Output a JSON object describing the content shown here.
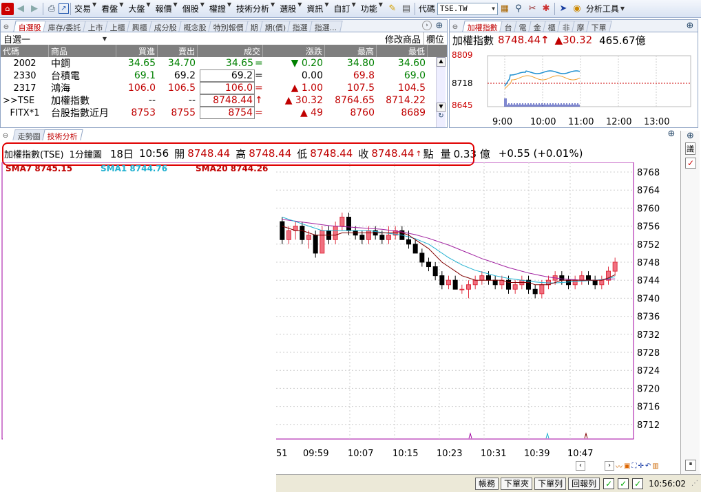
{
  "toolbar": {
    "menus": [
      "交易",
      "看盤",
      "大盤",
      "報價",
      "個股",
      "權證",
      "技術分析",
      "選股",
      "資訊",
      "自訂",
      "功能"
    ],
    "code_label": "代碼",
    "code_value": "TSE.TW",
    "analysis_tools": "分析工具"
  },
  "quote_panel": {
    "tabs": [
      "自選股",
      "庫存/委託",
      "上市",
      "上櫃",
      "興櫃",
      "成分股",
      "概念股",
      "特別報價",
      "期",
      "期(價)",
      "指選",
      "指選..."
    ],
    "group_name": "自選一",
    "edit_label": "修改商品",
    "column_label": "欄位",
    "headers": [
      "代碼",
      "商品",
      "買進",
      "賣出",
      "成交",
      "漲跌",
      "最高",
      "最低"
    ],
    "rows": [
      {
        "code": "2002",
        "name": "中鋼",
        "bid": "34.65",
        "ask": "34.70",
        "last": "34.65",
        "mark": "=",
        "chg": "0.20",
        "chg_sign": "down",
        "high": "34.80",
        "low": "34.60",
        "color": "dn"
      },
      {
        "code": "2330",
        "name": "台積電",
        "bid": "69.1",
        "ask": "69.2",
        "last": "69.2",
        "mark": "=",
        "chg": "0.00",
        "chg_sign": "none",
        "high": "69.8",
        "low": "69.0",
        "color": "flat"
      },
      {
        "code": "2317",
        "name": "鴻海",
        "bid": "106.0",
        "ask": "106.5",
        "last": "106.0",
        "mark": "=",
        "chg": "1.00",
        "chg_sign": "up",
        "high": "107.5",
        "low": "104.5",
        "color": "up"
      },
      {
        "code": ">>TSE",
        "name": "加權指數",
        "bid": "--",
        "ask": "--",
        "last": "8748.44",
        "mark": "↑",
        "chg": "30.32",
        "chg_sign": "up",
        "high": "8764.65",
        "low": "8714.22",
        "color": "up"
      },
      {
        "code": "FITX*1",
        "name": "台股指數近月",
        "bid": "8753",
        "ask": "8755",
        "last": "8754",
        "mark": "=",
        "chg": "49",
        "chg_sign": "up",
        "high": "8760",
        "low": "8689",
        "color": "up"
      }
    ]
  },
  "index_panel": {
    "tabs": [
      "加權指數",
      "台",
      "電",
      "金",
      "櫃",
      "非",
      "摩",
      "下單"
    ],
    "name": "加權指數",
    "value": "8748.44",
    "arrow": "↑",
    "change": "30.32",
    "volume": "465.67億",
    "y_ticks": [
      "8809",
      "8718",
      "8645"
    ],
    "x_ticks": [
      "9:00",
      "10:00",
      "11:00",
      "12:00",
      "13:00"
    ]
  },
  "chart_panel": {
    "tabs": [
      "走勢圖",
      "技術分析"
    ],
    "title": "加權指數(TSE)",
    "period": "1分鐘圖",
    "date": "18日",
    "time": "10:56",
    "open_label": "開",
    "open": "8748.44",
    "high_label": "高",
    "high": "8748.44",
    "low_label": "低",
    "low": "8748.44",
    "close_label": "收",
    "close": "8748.44",
    "points_label": "點",
    "volume_label": "量",
    "volume": "0.33 億",
    "change": "+0.55 (+0.01%)",
    "ma_labels": [
      "SMA7 8745.15",
      "SMA1 8744.76",
      "SMA20 8744.26"
    ],
    "y_ticks": [
      "8768",
      "8764",
      "8760",
      "8756",
      "8752",
      "8748",
      "8744",
      "8740",
      "8736",
      "8732",
      "8728",
      "8724",
      "8720",
      "8716",
      "8712"
    ],
    "x_ticks": [
      "51",
      "09:59",
      "10:07",
      "10:15",
      "10:23",
      "10:31",
      "10:39",
      "10:47"
    ],
    "side_label": "議"
  },
  "status_bar": {
    "buttons": [
      "帳務",
      "下單夾",
      "下單列",
      "回報列"
    ],
    "time": "10:56:02"
  },
  "chart_data": {
    "type": "candlestick",
    "ylim": [
      8710,
      8770
    ],
    "y_ticks": [
      8768,
      8764,
      8760,
      8756,
      8752,
      8748,
      8744,
      8740,
      8736,
      8732,
      8728,
      8724,
      8720,
      8716,
      8712
    ],
    "x_ticks": [
      "09:59",
      "10:07",
      "10:15",
      "10:23",
      "10:31",
      "10:39",
      "10:47"
    ],
    "candles": [
      [
        8757,
        8758,
        8752,
        8753
      ],
      [
        8753,
        8756,
        8752,
        8755
      ],
      [
        8755,
        8757,
        8753,
        8756
      ],
      [
        8756,
        8757,
        8752,
        8753
      ],
      [
        8753,
        8755,
        8751,
        8754
      ],
      [
        8754,
        8755,
        8749,
        8750
      ],
      [
        8750,
        8756,
        8750,
        8755
      ],
      [
        8755,
        8756,
        8752,
        8753
      ],
      [
        8753,
        8757,
        8752,
        8756
      ],
      [
        8756,
        8759,
        8755,
        8758
      ],
      [
        8758,
        8759,
        8754,
        8755
      ],
      [
        8755,
        8756,
        8753,
        8754
      ],
      [
        8754,
        8755,
        8752,
        8753
      ],
      [
        8753,
        8756,
        8752,
        8755
      ],
      [
        8755,
        8756,
        8753,
        8754
      ],
      [
        8754,
        8755,
        8752,
        8753
      ],
      [
        8753,
        8756,
        8752,
        8754
      ],
      [
        8754,
        8756,
        8753,
        8755
      ],
      [
        8755,
        8756,
        8753,
        8753
      ],
      [
        8753,
        8755,
        8751,
        8752
      ],
      [
        8752,
        8753,
        8750,
        8750
      ],
      [
        8750,
        8751,
        8747,
        8748
      ],
      [
        8748,
        8749,
        8746,
        8747
      ],
      [
        8747,
        8748,
        8744,
        8745
      ],
      [
        8745,
        8746,
        8742,
        8743
      ],
      [
        8743,
        8745,
        8742,
        8744
      ],
      [
        8744,
        8745,
        8742,
        8742
      ],
      [
        8742,
        8743,
        8741,
        8742
      ],
      [
        8742,
        8744,
        8740,
        8743
      ],
      [
        8743,
        8745,
        8742,
        8744
      ],
      [
        8744,
        8746,
        8743,
        8745
      ],
      [
        8745,
        8746,
        8743,
        8744
      ],
      [
        8744,
        8745,
        8742,
        8743
      ],
      [
        8743,
        8745,
        8742,
        8744
      ],
      [
        8744,
        8745,
        8741,
        8742
      ],
      [
        8742,
        8744,
        8741,
        8743
      ],
      [
        8743,
        8745,
        8742,
        8744
      ],
      [
        8744,
        8745,
        8741,
        8742
      ],
      [
        8742,
        8743,
        8740,
        8741
      ],
      [
        8741,
        8744,
        8740,
        8743
      ],
      [
        8743,
        8745,
        8742,
        8744
      ],
      [
        8744,
        8746,
        8743,
        8745
      ],
      [
        8745,
        8746,
        8743,
        8744
      ],
      [
        8744,
        8745,
        8742,
        8743
      ],
      [
        8743,
        8745,
        8742,
        8744
      ],
      [
        8744,
        8746,
        8743,
        8745
      ],
      [
        8745,
        8746,
        8743,
        8744
      ],
      [
        8744,
        8745,
        8742,
        8743
      ],
      [
        8743,
        8745,
        8742,
        8744
      ],
      [
        8744,
        8747,
        8743,
        8746
      ],
      [
        8746,
        8749,
        8745,
        8748
      ]
    ],
    "sma7": [
      8756,
      8755.5,
      8755,
      8755,
      8754.5,
      8754,
      8754,
      8754,
      8754,
      8754.5,
      8754.5,
      8754.5,
      8754.5,
      8754.5,
      8754.5,
      8754.5,
      8754.5,
      8754.5,
      8754.5,
      8754,
      8753,
      8752,
      8751,
      8749.5,
      8748,
      8747,
      8746,
      8745,
      8744.5,
      8744,
      8744,
      8744,
      8744,
      8744,
      8743.5,
      8743.5,
      8743.5,
      8743.5,
      8743,
      8743,
      8743,
      8743.5,
      8744,
      8744,
      8744,
      8744,
      8744,
      8744,
      8744,
      8744.5,
      8745.2
    ],
    "sma1": [
      8758,
      8757.5,
      8757,
      8756.5,
      8756,
      8755.5,
      8755,
      8755,
      8755,
      8755,
      8755,
      8755,
      8755,
      8755,
      8754.8,
      8754.6,
      8754.4,
      8754.2,
      8754,
      8753.6,
      8753.2,
      8752.6,
      8752,
      8751,
      8750,
      8749,
      8748.2,
      8747.4,
      8746.8,
      8746.2,
      8745.8,
      8745.4,
      8745,
      8744.7,
      8744.4,
      8744.2,
      8744,
      8743.8,
      8743.6,
      8743.5,
      8743.4,
      8743.4,
      8743.5,
      8743.6,
      8743.7,
      8743.8,
      8743.9,
      8744,
      8744.1,
      8744.4,
      8744.8
    ],
    "sma20": [
      8757.5,
      8757.3,
      8757.1,
      8756.9,
      8756.7,
      8756.5,
      8756.3,
      8756.1,
      8756,
      8755.9,
      8755.8,
      8755.7,
      8755.6,
      8755.5,
      8755.4,
      8755.3,
      8755.1,
      8754.9,
      8754.7,
      8754.4,
      8754.1,
      8753.7,
      8753.3,
      8752.8,
      8752.3,
      8751.8,
      8751.2,
      8750.6,
      8750,
      8749.4,
      8748.8,
      8748.3,
      8747.8,
      8747.3,
      8746.8,
      8746.4,
      8746,
      8745.6,
      8745.3,
      8745,
      8744.7,
      8744.5,
      8744.3,
      8744.2,
      8744.1,
      8744,
      8744,
      8744,
      8744.1,
      8744.2,
      8744.3
    ]
  }
}
